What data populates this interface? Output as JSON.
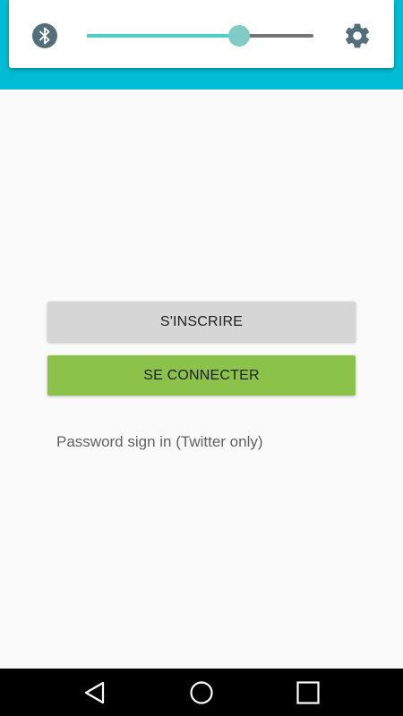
{
  "quick_settings": {
    "brightness_level": 0.67,
    "colors": {
      "header_background": "#00bcd4",
      "slider_active": "#4dd0c6",
      "slider_thumb": "#80cbc4",
      "slider_inactive": "#757575",
      "icon": "#546e7a"
    },
    "icons": [
      "bluetooth-icon",
      "gear-icon"
    ]
  },
  "main": {
    "signup_label": "S'INSCRIRE",
    "login_label": "SE CONNECTER",
    "password_link": "Password sign in (Twitter only)",
    "colors": {
      "signup_button": "#d6d6d6",
      "login_button": "#8bc34a",
      "background": "#fafafa"
    }
  },
  "nav_bar": {
    "icons": [
      "back-icon",
      "home-icon",
      "recent-apps-icon"
    ]
  }
}
